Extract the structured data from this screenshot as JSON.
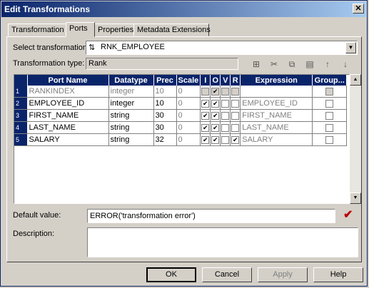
{
  "window": {
    "title": "Edit Transformations"
  },
  "tabs": [
    "Transformation",
    "Ports",
    "Properties",
    "Metadata Extensions"
  ],
  "select_transformation": {
    "label": "Select transformation:",
    "value": "RNK_EMPLOYEE",
    "icon": "rank-transformation-icon"
  },
  "transformation_type": {
    "label": "Transformation type:",
    "value": "Rank"
  },
  "toolbar": [
    "new-port-icon",
    "cut-icon",
    "copy-icon",
    "paste-icon",
    "move-up-icon",
    "move-down-icon"
  ],
  "grid": {
    "columns": [
      "Port Name",
      "Datatype",
      "Prec",
      "Scale",
      "I",
      "O",
      "V",
      "R",
      "Expression",
      "Group..."
    ],
    "rows": [
      {
        "num": "1",
        "name": "RANKINDEX",
        "datatype": "integer",
        "prec": "10",
        "scale": "0",
        "I": false,
        "O": true,
        "V": false,
        "R": false,
        "expr": "",
        "group": false,
        "disabled": true
      },
      {
        "num": "2",
        "name": "EMPLOYEE_ID",
        "datatype": "integer",
        "prec": "10",
        "scale": "0",
        "I": true,
        "O": true,
        "V": false,
        "R": false,
        "expr": "EMPLOYEE_ID",
        "group": false,
        "disabled": false
      },
      {
        "num": "3",
        "name": "FIRST_NAME",
        "datatype": "string",
        "prec": "30",
        "scale": "0",
        "I": true,
        "O": true,
        "V": false,
        "R": false,
        "expr": "FIRST_NAME",
        "group": false,
        "disabled": false
      },
      {
        "num": "4",
        "name": "LAST_NAME",
        "datatype": "string",
        "prec": "30",
        "scale": "0",
        "I": true,
        "O": true,
        "V": false,
        "R": false,
        "expr": "LAST_NAME",
        "group": false,
        "disabled": false
      },
      {
        "num": "5",
        "name": "SALARY",
        "datatype": "string",
        "prec": "32",
        "scale": "0",
        "I": true,
        "O": true,
        "V": false,
        "R": true,
        "expr": "SALARY",
        "group": false,
        "disabled": false
      }
    ]
  },
  "default_value": {
    "label": "Default value:",
    "value": "ERROR('transformation error')"
  },
  "description": {
    "label": "Description:",
    "value": ""
  },
  "buttons": {
    "ok": "OK",
    "cancel": "Cancel",
    "apply": "Apply",
    "help": "Help"
  }
}
